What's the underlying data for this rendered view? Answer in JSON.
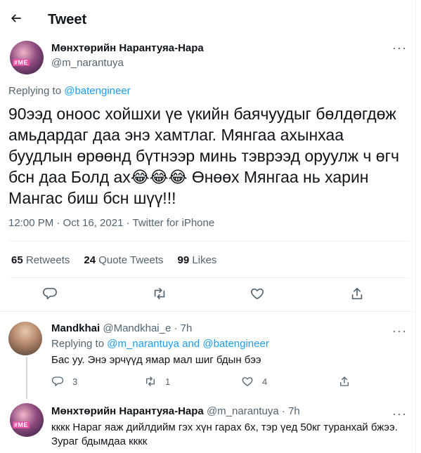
{
  "header": {
    "title": "Tweet"
  },
  "main_tweet": {
    "author_name": "Мөнхтөрийн Нарантуяа-Нара",
    "author_handle": "@m_narantuya",
    "avatar_tag": "#ME",
    "replying_prefix": "Replying to",
    "replying_to": "@batengineer",
    "text": "90ээд оноос хойшхи үе үкийн баячуудыг бөлдөгдөж амьдардаг даа энэ хамтлаг. Мянгаа ахынхаа буудлын өрөөнд бүтнээр минь тэврээд оруулж ч өгч бсн даа Болд ах😂😂😂 Өнөөх Мянгаа нь харин Мангас биш бсн шүү!!!",
    "timestamp": "12:00 PM · Oct 16, 2021 · Twitter for iPhone",
    "stats": {
      "retweets_count": "65",
      "retweets_label": "Retweets",
      "quotes_count": "24",
      "quotes_label": "Quote Tweets",
      "likes_count": "99",
      "likes_label": "Likes"
    }
  },
  "replies": [
    {
      "author_name": "Mandkhai",
      "author_handle": "@Mandkhai_e",
      "time": "· 7h",
      "replying_prefix": "Replying to",
      "replying_to": "@m_narantuya and @batengineer",
      "text": "Бас уу. Энэ эрчүүд ямар мал шиг бдын бээ",
      "reply_count": "3",
      "retweet_count": "1",
      "like_count": "4"
    },
    {
      "author_name": "Мөнхтөрийн Нарантуяа-Нара",
      "author_handle": "@m_narantuya",
      "time": "· 7h",
      "avatar_tag": "#ME",
      "text": "кккк Нараг яаж дийлдийм гэх хүн гарах 6х, тэр үед 50кг туранхай бжээ. Зураг бдымдаа кккк"
    }
  ],
  "icons": {
    "back": "arrow-left-icon",
    "more": "more-dots-icon",
    "reply": "reply-bubble-icon",
    "retweet": "retweet-icon",
    "like": "heart-icon",
    "share": "share-icon"
  },
  "colors": {
    "accent": "#1d9bf0",
    "secondary_text": "#536471",
    "divider": "#eff3f4"
  }
}
